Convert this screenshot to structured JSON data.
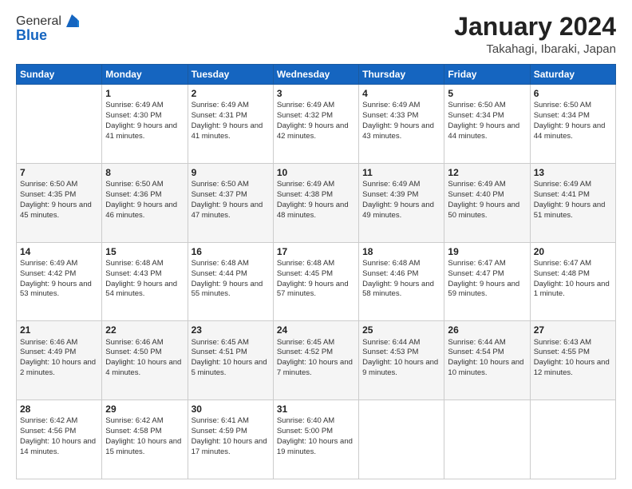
{
  "header": {
    "logo_general": "General",
    "logo_blue": "Blue",
    "title": "January 2024",
    "location": "Takahagi, Ibaraki, Japan"
  },
  "days_of_week": [
    "Sunday",
    "Monday",
    "Tuesday",
    "Wednesday",
    "Thursday",
    "Friday",
    "Saturday"
  ],
  "weeks": [
    [
      {
        "day": "",
        "sunrise": "",
        "sunset": "",
        "daylight": ""
      },
      {
        "day": "1",
        "sunrise": "Sunrise: 6:49 AM",
        "sunset": "Sunset: 4:30 PM",
        "daylight": "Daylight: 9 hours and 41 minutes."
      },
      {
        "day": "2",
        "sunrise": "Sunrise: 6:49 AM",
        "sunset": "Sunset: 4:31 PM",
        "daylight": "Daylight: 9 hours and 41 minutes."
      },
      {
        "day": "3",
        "sunrise": "Sunrise: 6:49 AM",
        "sunset": "Sunset: 4:32 PM",
        "daylight": "Daylight: 9 hours and 42 minutes."
      },
      {
        "day": "4",
        "sunrise": "Sunrise: 6:49 AM",
        "sunset": "Sunset: 4:33 PM",
        "daylight": "Daylight: 9 hours and 43 minutes."
      },
      {
        "day": "5",
        "sunrise": "Sunrise: 6:50 AM",
        "sunset": "Sunset: 4:34 PM",
        "daylight": "Daylight: 9 hours and 44 minutes."
      },
      {
        "day": "6",
        "sunrise": "Sunrise: 6:50 AM",
        "sunset": "Sunset: 4:34 PM",
        "daylight": "Daylight: 9 hours and 44 minutes."
      }
    ],
    [
      {
        "day": "7",
        "sunrise": "Sunrise: 6:50 AM",
        "sunset": "Sunset: 4:35 PM",
        "daylight": "Daylight: 9 hours and 45 minutes."
      },
      {
        "day": "8",
        "sunrise": "Sunrise: 6:50 AM",
        "sunset": "Sunset: 4:36 PM",
        "daylight": "Daylight: 9 hours and 46 minutes."
      },
      {
        "day": "9",
        "sunrise": "Sunrise: 6:50 AM",
        "sunset": "Sunset: 4:37 PM",
        "daylight": "Daylight: 9 hours and 47 minutes."
      },
      {
        "day": "10",
        "sunrise": "Sunrise: 6:49 AM",
        "sunset": "Sunset: 4:38 PM",
        "daylight": "Daylight: 9 hours and 48 minutes."
      },
      {
        "day": "11",
        "sunrise": "Sunrise: 6:49 AM",
        "sunset": "Sunset: 4:39 PM",
        "daylight": "Daylight: 9 hours and 49 minutes."
      },
      {
        "day": "12",
        "sunrise": "Sunrise: 6:49 AM",
        "sunset": "Sunset: 4:40 PM",
        "daylight": "Daylight: 9 hours and 50 minutes."
      },
      {
        "day": "13",
        "sunrise": "Sunrise: 6:49 AM",
        "sunset": "Sunset: 4:41 PM",
        "daylight": "Daylight: 9 hours and 51 minutes."
      }
    ],
    [
      {
        "day": "14",
        "sunrise": "Sunrise: 6:49 AM",
        "sunset": "Sunset: 4:42 PM",
        "daylight": "Daylight: 9 hours and 53 minutes."
      },
      {
        "day": "15",
        "sunrise": "Sunrise: 6:48 AM",
        "sunset": "Sunset: 4:43 PM",
        "daylight": "Daylight: 9 hours and 54 minutes."
      },
      {
        "day": "16",
        "sunrise": "Sunrise: 6:48 AM",
        "sunset": "Sunset: 4:44 PM",
        "daylight": "Daylight: 9 hours and 55 minutes."
      },
      {
        "day": "17",
        "sunrise": "Sunrise: 6:48 AM",
        "sunset": "Sunset: 4:45 PM",
        "daylight": "Daylight: 9 hours and 57 minutes."
      },
      {
        "day": "18",
        "sunrise": "Sunrise: 6:48 AM",
        "sunset": "Sunset: 4:46 PM",
        "daylight": "Daylight: 9 hours and 58 minutes."
      },
      {
        "day": "19",
        "sunrise": "Sunrise: 6:47 AM",
        "sunset": "Sunset: 4:47 PM",
        "daylight": "Daylight: 9 hours and 59 minutes."
      },
      {
        "day": "20",
        "sunrise": "Sunrise: 6:47 AM",
        "sunset": "Sunset: 4:48 PM",
        "daylight": "Daylight: 10 hours and 1 minute."
      }
    ],
    [
      {
        "day": "21",
        "sunrise": "Sunrise: 6:46 AM",
        "sunset": "Sunset: 4:49 PM",
        "daylight": "Daylight: 10 hours and 2 minutes."
      },
      {
        "day": "22",
        "sunrise": "Sunrise: 6:46 AM",
        "sunset": "Sunset: 4:50 PM",
        "daylight": "Daylight: 10 hours and 4 minutes."
      },
      {
        "day": "23",
        "sunrise": "Sunrise: 6:45 AM",
        "sunset": "Sunset: 4:51 PM",
        "daylight": "Daylight: 10 hours and 5 minutes."
      },
      {
        "day": "24",
        "sunrise": "Sunrise: 6:45 AM",
        "sunset": "Sunset: 4:52 PM",
        "daylight": "Daylight: 10 hours and 7 minutes."
      },
      {
        "day": "25",
        "sunrise": "Sunrise: 6:44 AM",
        "sunset": "Sunset: 4:53 PM",
        "daylight": "Daylight: 10 hours and 9 minutes."
      },
      {
        "day": "26",
        "sunrise": "Sunrise: 6:44 AM",
        "sunset": "Sunset: 4:54 PM",
        "daylight": "Daylight: 10 hours and 10 minutes."
      },
      {
        "day": "27",
        "sunrise": "Sunrise: 6:43 AM",
        "sunset": "Sunset: 4:55 PM",
        "daylight": "Daylight: 10 hours and 12 minutes."
      }
    ],
    [
      {
        "day": "28",
        "sunrise": "Sunrise: 6:42 AM",
        "sunset": "Sunset: 4:56 PM",
        "daylight": "Daylight: 10 hours and 14 minutes."
      },
      {
        "day": "29",
        "sunrise": "Sunrise: 6:42 AM",
        "sunset": "Sunset: 4:58 PM",
        "daylight": "Daylight: 10 hours and 15 minutes."
      },
      {
        "day": "30",
        "sunrise": "Sunrise: 6:41 AM",
        "sunset": "Sunset: 4:59 PM",
        "daylight": "Daylight: 10 hours and 17 minutes."
      },
      {
        "day": "31",
        "sunrise": "Sunrise: 6:40 AM",
        "sunset": "Sunset: 5:00 PM",
        "daylight": "Daylight: 10 hours and 19 minutes."
      },
      {
        "day": "",
        "sunrise": "",
        "sunset": "",
        "daylight": ""
      },
      {
        "day": "",
        "sunrise": "",
        "sunset": "",
        "daylight": ""
      },
      {
        "day": "",
        "sunrise": "",
        "sunset": "",
        "daylight": ""
      }
    ]
  ]
}
